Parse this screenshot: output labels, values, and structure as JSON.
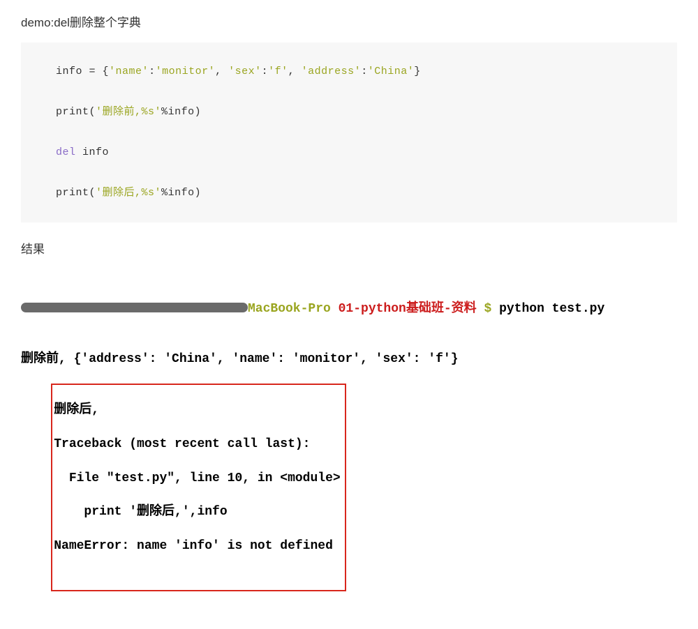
{
  "heading": "demo:del删除整个字典",
  "code": {
    "l1": {
      "a": "info ",
      "op": "= ",
      "b": "{",
      "s1": "'name'",
      "c1": ":",
      "s2": "'monitor'",
      "c2": ", ",
      "s3": "'sex'",
      "c3": ":",
      "s4": "'f'",
      "c4": ", ",
      "s5": "'address'",
      "c5": ":",
      "s6": "'China'",
      "end": "}"
    },
    "l2": {
      "fn": "print",
      "op": "(",
      "s": "'删除前,%s'",
      "pct": "%",
      "id": "info",
      "cl": ")"
    },
    "l3": {
      "kw": "del",
      "sp": " ",
      "id": "info"
    },
    "l4": {
      "fn": "print",
      "op": "(",
      "s": "'删除后,%s'",
      "pct": "%",
      "id": "info",
      "cl": ")"
    }
  },
  "result_label": "结果",
  "term": {
    "host": "MacBook-Pro ",
    "path": "01-python基础班-资料 ",
    "dollar": "$ ",
    "cmd": "python test.py",
    "line_before": "删除前, {'address': 'China', 'name': 'monitor', 'sex': 'f'}",
    "box": {
      "l1": "删除后,",
      "l2": "Traceback (most recent call last):",
      "l3": "  File \"test.py\", line 10, in <module>",
      "l4": "    print '删除后,',info",
      "l5": "NameError: name 'info' is not defined"
    }
  }
}
